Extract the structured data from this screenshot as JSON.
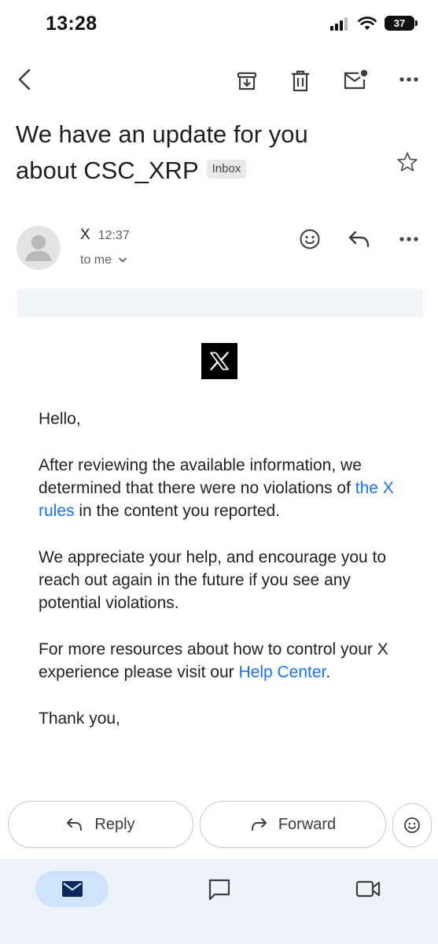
{
  "status_bar": {
    "time": "13:28",
    "battery": "37"
  },
  "toolbar": {
    "back_icon": "back-arrow-icon",
    "archive_icon": "archive-icon",
    "delete_icon": "delete-icon",
    "mark_unread_icon": "mark-unread-icon",
    "more_icon": "more-vertical-icon"
  },
  "email": {
    "subject_line1": "We have an update for you",
    "subject_line2": "about CSC_XRP",
    "label": "Inbox",
    "sender": "X",
    "time": "12:37",
    "recipient": "to me",
    "body": {
      "greeting": "Hello,",
      "p1_before_link": "After reviewing the available information, we determined that there were no violations of ",
      "p1_link": "the X rules",
      "p1_after_link": " in the content you reported.",
      "p2": "We appreciate your help, and encourage you to reach out again in the future if you see any potential violations.",
      "p3_before_link": "For more resources about how to control your X experience please visit our ",
      "p3_link": "Help Center",
      "p3_after_link": ".",
      "closing": "Thank you,"
    }
  },
  "actions": {
    "reply": "Reply",
    "forward": "Forward"
  },
  "bottom_nav": {
    "items": [
      "mail-icon",
      "chat-icon",
      "meet-video-icon"
    ],
    "accent": "#cfe3fb"
  }
}
